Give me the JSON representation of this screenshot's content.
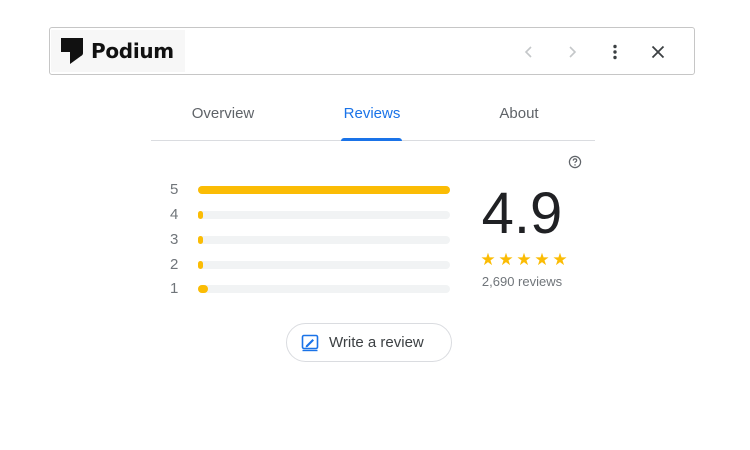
{
  "header": {
    "brand": "Podium",
    "icons": {
      "back": "chevron-left-icon",
      "forward": "chevron-right-icon",
      "more": "more-vert-icon",
      "close": "close-icon"
    }
  },
  "tabs": [
    {
      "label": "Overview",
      "selected": false
    },
    {
      "label": "Reviews",
      "selected": true
    },
    {
      "label": "About",
      "selected": false
    }
  ],
  "ratings": {
    "average": "4.9",
    "star_count": 5,
    "reviews_count": "2,690 reviews",
    "distribution": [
      {
        "stars": "5",
        "fraction": 1.0
      },
      {
        "stars": "4",
        "fraction": 0.02
      },
      {
        "stars": "3",
        "fraction": 0.01
      },
      {
        "stars": "2",
        "fraction": 0.01
      },
      {
        "stars": "1",
        "fraction": 0.04
      }
    ]
  },
  "write_review": {
    "label": "Write a review",
    "icon": "write-review-icon"
  },
  "colors": {
    "accent": "#1a73e8",
    "star": "#fbbc04",
    "bar_track": "#f1f3f4",
    "muted_text": "#70757a"
  }
}
